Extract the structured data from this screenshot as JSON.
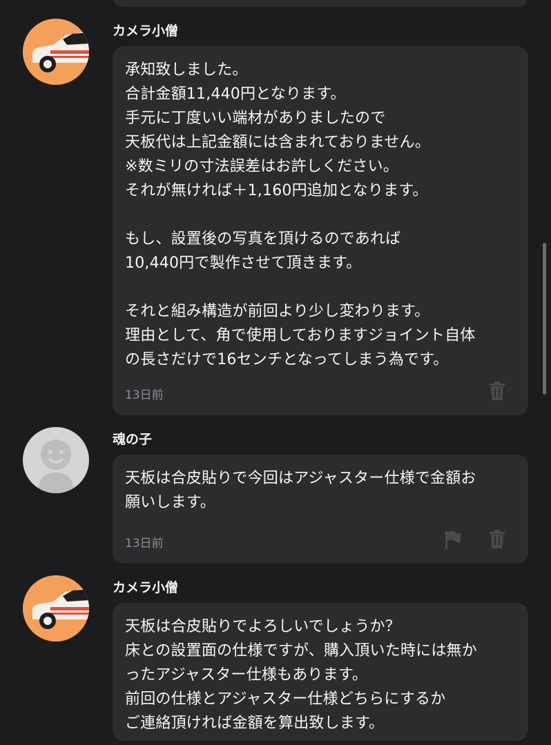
{
  "messages": [
    {
      "sender": "カメラ小僧",
      "avatar": "camera-kozo-avatar",
      "text": "承知致しました。\n合計金額11,440円となります。\n手元に丁度いい端材がありましたので\n天板代は上記金額には含まれておりません。\n※数ミリの寸法誤差はお許しください。\nそれが無ければ＋1,160円追加となります。\n\nもし、設置後の写真を頂けるのであれば\n10,440円で製作させて頂きます。\n\nそれと組み構造が前回より少し変わります。\n理由として、角で使用しておりますジョイント自体\nの長さだけで16センチとなってしまう為です。",
      "timestamp": "13日前"
    },
    {
      "sender": "魂の子",
      "avatar": "default-user-avatar",
      "text": "天板は合皮貼りで今回はアジャスター仕様で金額お\n願いします。",
      "timestamp": "13日前"
    },
    {
      "sender": "カメラ小僧",
      "avatar": "camera-kozo-avatar",
      "text": "天板は合皮貼りでよろしいでしょうか？\n床との設置面の仕様ですが、購入頂いた時には無か\nったアジャスター仕様もあります。\n前回の仕様とアジャスター仕様どちらにするか\nご連絡頂ければ金額を算出致します。"
    }
  ],
  "icons": {
    "trash": "trash-icon",
    "flag": "flag-icon"
  },
  "colors": {
    "background": "#1c1c1e",
    "bubble": "#2c2c2e",
    "timestamp": "#8e8e93",
    "avatar_orange": "#f5a05a",
    "avatar_gray": "#d5d5d7"
  }
}
